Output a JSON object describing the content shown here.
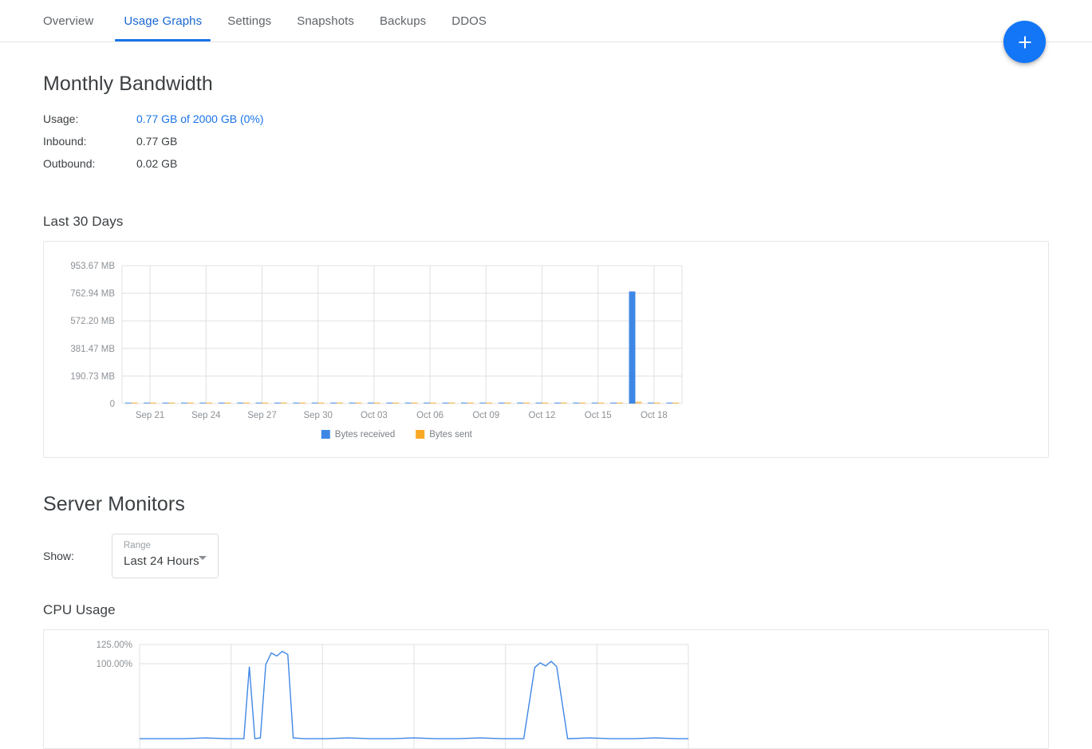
{
  "tabs": [
    {
      "label": "Overview",
      "active": false
    },
    {
      "label": "Usage Graphs",
      "active": true
    },
    {
      "label": "Settings",
      "active": false
    },
    {
      "label": "Snapshots",
      "active": false
    },
    {
      "label": "Backups",
      "active": false
    },
    {
      "label": "DDOS",
      "active": false
    }
  ],
  "fab": {
    "icon": "plus-icon",
    "label": "+"
  },
  "bandwidth": {
    "title": "Monthly Bandwidth",
    "rows": [
      {
        "label": "Usage:",
        "value": "0.77 GB of 2000 GB (0%)",
        "is_link": true
      },
      {
        "label": "Inbound:",
        "value": "0.77 GB",
        "is_link": false
      },
      {
        "label": "Outbound:",
        "value": "0.02 GB",
        "is_link": false
      }
    ],
    "chart_title": "Last 30 Days"
  },
  "monitors": {
    "title": "Server Monitors",
    "show_label": "Show:",
    "range_floating_label": "Range",
    "range_value": "Last 24 Hours",
    "cpu_title": "CPU Usage"
  },
  "colors": {
    "accent": "#1a73e8",
    "fab": "#1276f7",
    "series_received": "#3f87e5",
    "series_sent": "#f9a825",
    "grid": "#e0e0e0",
    "text": "#3c4043",
    "muted": "#8c9196"
  },
  "chart_data": [
    {
      "type": "bar",
      "title": "Last 30 Days",
      "xlabel": "",
      "ylabel": "",
      "ylim": [
        0,
        953.67
      ],
      "yunit": "MB",
      "ytick_labels": [
        "0",
        "190.73 MB",
        "381.47 MB",
        "572.20 MB",
        "762.94 MB",
        "953.67 MB"
      ],
      "ytick_values": [
        0,
        190.73,
        381.47,
        572.2,
        762.94,
        953.67
      ],
      "xtick_labels": [
        "Sep 21",
        "Sep 24",
        "Sep 27",
        "Sep 30",
        "Oct 03",
        "Oct 06",
        "Oct 09",
        "Oct 12",
        "Oct 15",
        "Oct 18"
      ],
      "grid": true,
      "legend_position": "bottom",
      "series": [
        {
          "name": "Bytes received",
          "color": "#3f87e5",
          "values": [
            4,
            3,
            5,
            4,
            3,
            4,
            6,
            4,
            3,
            5,
            4,
            3,
            4,
            5,
            4,
            3,
            6,
            4,
            3,
            4,
            5,
            4,
            3,
            4,
            5,
            4,
            3,
            775,
            4,
            3
          ]
        },
        {
          "name": "Bytes sent",
          "color": "#f9a825",
          "values": [
            5,
            4,
            6,
            5,
            4,
            5,
            7,
            5,
            4,
            6,
            5,
            4,
            5,
            6,
            5,
            4,
            7,
            5,
            4,
            5,
            6,
            5,
            4,
            5,
            6,
            5,
            4,
            14,
            5,
            4
          ]
        }
      ]
    },
    {
      "type": "line",
      "title": "CPU Usage",
      "xlabel": "",
      "ylabel": "",
      "ylim": [
        0,
        125
      ],
      "yunit": "%",
      "ytick_labels": [
        "100.00%",
        "125.00%"
      ],
      "ytick_values": [
        100,
        125
      ],
      "grid": true,
      "series": [
        {
          "name": "CPU",
          "color": "#3f87e5",
          "x": [
            0,
            4,
            8,
            12,
            16,
            19,
            20,
            21,
            22,
            23,
            24,
            25,
            26,
            27,
            28,
            30,
            34,
            38,
            42,
            46,
            50,
            54,
            58,
            62,
            66,
            70,
            72,
            73,
            74,
            75,
            76,
            78,
            82,
            86,
            90,
            94,
            98,
            100
          ],
          "values": [
            2,
            2,
            2,
            3,
            2,
            2,
            96,
            2,
            3,
            99,
            114,
            110,
            116,
            112,
            3,
            2,
            2,
            3,
            2,
            2,
            3,
            2,
            2,
            3,
            2,
            2,
            95,
            101,
            97,
            103,
            96,
            2,
            3,
            2,
            2,
            3,
            2,
            2
          ]
        }
      ]
    }
  ]
}
